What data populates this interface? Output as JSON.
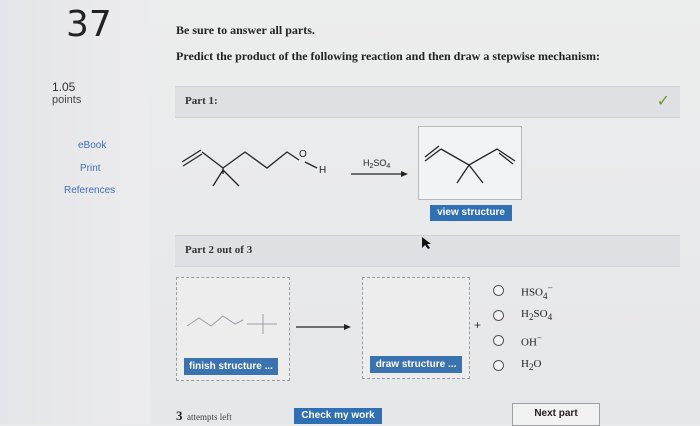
{
  "question": {
    "number": "37",
    "points_value": "1.05",
    "points_label": "points"
  },
  "sidebar": {
    "links": [
      "eBook",
      "Print",
      "References"
    ]
  },
  "instructions": {
    "line1": "Be sure to answer all parts.",
    "line2": "Predict the product of the following reaction and then draw a stepwise mechanism:"
  },
  "part1": {
    "label": "Part 1:",
    "reagent": "H2SO4",
    "hydroxyl_o": "O",
    "hydroxyl_h": "H",
    "view_button": "view structure"
  },
  "part2": {
    "label": "Part 2 out of 3",
    "finish_button": "finish structure ...",
    "draw_button": "draw structure ...",
    "plus_sign": "+",
    "options": [
      {
        "base": "HSO",
        "sub": "4",
        "sup": "−"
      },
      {
        "base": "H",
        "sub": "2",
        "base2": "SO",
        "sub2": "4"
      },
      {
        "base": "OH",
        "sup": "−"
      },
      {
        "base": "H",
        "sub": "2",
        "base2": "O"
      }
    ]
  },
  "footer": {
    "attempts_count": "3",
    "attempts_text": "attempts left",
    "check_button": "Check my work",
    "next_button": "Next part"
  },
  "colors": {
    "button_blue": "#2f6fb3",
    "checkmark_green": "#6a9a2a"
  }
}
